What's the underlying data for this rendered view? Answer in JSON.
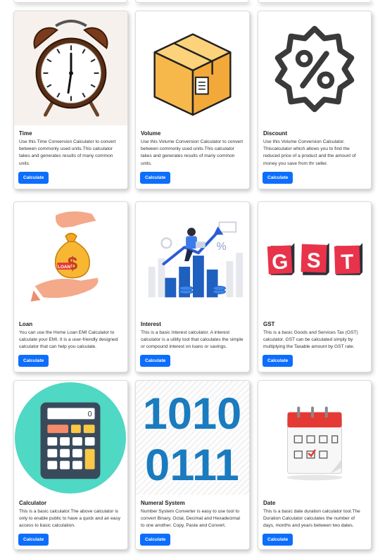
{
  "cards": [
    {
      "title": "Time",
      "text": "Use this Time Conversion Calculator to convert between commonly used units.This calculator takes and generates results of many common units.",
      "button": "Calculate",
      "icon": "alarm-clock"
    },
    {
      "title": "Volume",
      "text": "Use this Volume Conversion Calculator to convert between commonly used units.This calculator takes and generates results of many common units.",
      "button": "Calculate",
      "icon": "cardboard-box"
    },
    {
      "title": "Discount",
      "text": "Use this Volume Conversion Calculator. Thiscalculator which allows you to find the reduced price of a product and the amount of money you save from thr seller.",
      "button": "Calculate",
      "icon": "percent-badge"
    },
    {
      "title": "Loan",
      "text": "You can use the Home Loan EMI Calculator to calculate your EMI. It is a user-friendly designed calculator that can help you calculate.",
      "button": "Calculate",
      "icon": "money-bag-hands",
      "image_label": "LOAN"
    },
    {
      "title": "Interest",
      "text": "This is a basic Interest calculator. A interest calculator is a utility tool that calculates the simple or compound interest on loans or savings.",
      "button": "Calculate",
      "icon": "growth-chart-person"
    },
    {
      "title": "GST",
      "text": "This is a basic Goods and Services Tax (GST) calculator. GST can be calculated simply by multiplying the Taxable amount by GST rate.",
      "button": "Calculate",
      "icon": "gst-blocks",
      "image_letters": [
        "G",
        "S",
        "T"
      ]
    },
    {
      "title": "Calculator",
      "text": "This is a basic calculator.The above calculator is only to enable public to have a quick and an easy access to basic calculation.",
      "button": "Calculate",
      "icon": "calculator",
      "image_display": "0"
    },
    {
      "title": "Numeral System",
      "text": "Number System Converter is easy to use tool to convert Binary, Octal, Decimal and Hexadecimal to one another. Copy, Paste and Convert.",
      "button": "Calculate",
      "icon": "binary-digits",
      "image_lines": [
        "1010",
        "0111"
      ]
    },
    {
      "title": "Date",
      "text": "This is a basic date duration calculator tool.The Duration Calculator calculates the number of days, months and years between two dates.",
      "button": "Calculate",
      "icon": "calendar"
    }
  ],
  "colors": {
    "button": "#0d6efd",
    "gst_red": "#e8334a",
    "calculator_bg": "#4fd8c4",
    "binary_blue": "#1a7bbf",
    "box_orange": "#f7b84b",
    "calendar_red": "#e53935"
  }
}
